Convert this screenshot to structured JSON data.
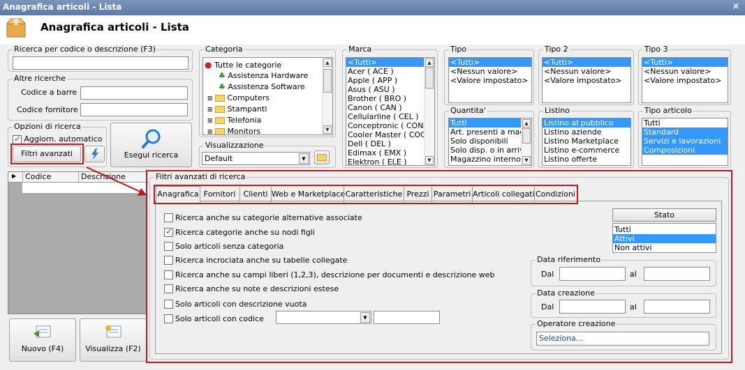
{
  "window": {
    "title": "Anagrafica articoli  - Lista",
    "close": "×"
  },
  "header": {
    "title": "Anagrafica articoli  - Lista"
  },
  "ricerca": {
    "label": "Ricerca per codice o descrizione (F3)",
    "value": ""
  },
  "altre": {
    "label": "Altre ricerche",
    "barcode_label": "Codice a barre :",
    "fornitore_label": "Codice fornitore :"
  },
  "opzioni": {
    "label": "Opzioni di ricerca",
    "auto_label": "Aggiorn. automatico",
    "filtri_label": "Filtri avanzati"
  },
  "esegui": {
    "label": "Esegui ricerca"
  },
  "categoria": {
    "label": "Categoria",
    "items": [
      {
        "label": "Tutte le categorie"
      },
      {
        "label": "Assistenza Hardware"
      },
      {
        "label": "Assistenza Software"
      },
      {
        "label": "Computers"
      },
      {
        "label": "Stampanti"
      },
      {
        "label": "Telefonia"
      },
      {
        "label": "Monitors"
      }
    ]
  },
  "visualizzazione": {
    "label": "Visualizzazione",
    "value": "Default"
  },
  "marca": {
    "label": "Marca",
    "items": [
      "<Tutti>",
      "Acer ( ACE )",
      "Apple ( APP )",
      "Asus ( ASU )",
      "Brother ( BRO )",
      "Canon ( CAN )",
      "Cellularline ( CEL )",
      "Conceptronic ( CON )",
      "Cooler Master ( COO )",
      "Dell ( DEL )",
      "Edimax ( EMX )",
      "Elektron ( ELE )"
    ]
  },
  "tipo": {
    "label": "Tipo",
    "items": [
      "<Tutti>",
      "<Nessun valore>",
      "<Valore impostato>"
    ]
  },
  "tipo2": {
    "label": "Tipo 2",
    "items": [
      "<Tutti>",
      "<Nessun valore>",
      "<Valore impostato>"
    ]
  },
  "tipo3": {
    "label": "Tipo 3",
    "items": [
      "<Tutti>",
      "<Nessun valore>",
      "<Valore impostato>"
    ]
  },
  "quantita": {
    "label": "Quantita'",
    "items": [
      "Tutti",
      "Art. presenti a magazzino",
      "Solo disponibili",
      "Solo disp. o in arrivo",
      "Magazzino interno"
    ]
  },
  "listino": {
    "label": "Listino",
    "items": [
      "Listino al pubblico",
      "Listino aziende",
      "Listino Marketplace",
      "Listino e-commerce",
      "Listino offerte"
    ]
  },
  "tipoart": {
    "label": "Tipo articolo",
    "items": [
      "Tutti",
      "Standard",
      "Servizi e lavorazioni",
      "Composizioni"
    ]
  },
  "grid": {
    "columns": [
      "Codice",
      "Descrizione"
    ]
  },
  "bottom": {
    "nuovo": "Nuovo (F4)",
    "visualizza": "Visualizza (F2)"
  },
  "filtri": {
    "label": "Filtri avanzati di ricerca",
    "tabs": [
      "Anagrafica",
      "Fornitori",
      "Clienti",
      "Web e Marketplace",
      "Caratteristiche",
      "Prezzi",
      "Parametri",
      "Articoli collegati",
      "Condizioni"
    ],
    "options": [
      {
        "label": "Ricerca anche su categorie alternative associate"
      },
      {
        "label": "Ricerca categorie anche su nodi figli"
      },
      {
        "label": "Solo articoli senza categoria"
      },
      {
        "label": "Ricerca incrociata anche su tabelle collegate"
      },
      {
        "label": "Ricerca anche su campi liberi (1,2,3), descrizione per documenti e descrizione web"
      },
      {
        "label": "Ricerca anche su note e descrizioni estese"
      },
      {
        "label": "Solo articoli con descrizione vuota"
      },
      {
        "label": "Solo articoli con codice"
      }
    ],
    "stato": {
      "header": "Stato",
      "items": [
        "Tutti",
        "Attivi",
        "Non attivi"
      ]
    },
    "data_rif": {
      "label": "Data riferimento",
      "dal": "Dal",
      "al": "al"
    },
    "data_cre": {
      "label": "Data creazione",
      "dal": "Dal",
      "al": "al"
    },
    "operatore": {
      "label": "Operatore creazione",
      "value": "Seleziona..."
    }
  }
}
